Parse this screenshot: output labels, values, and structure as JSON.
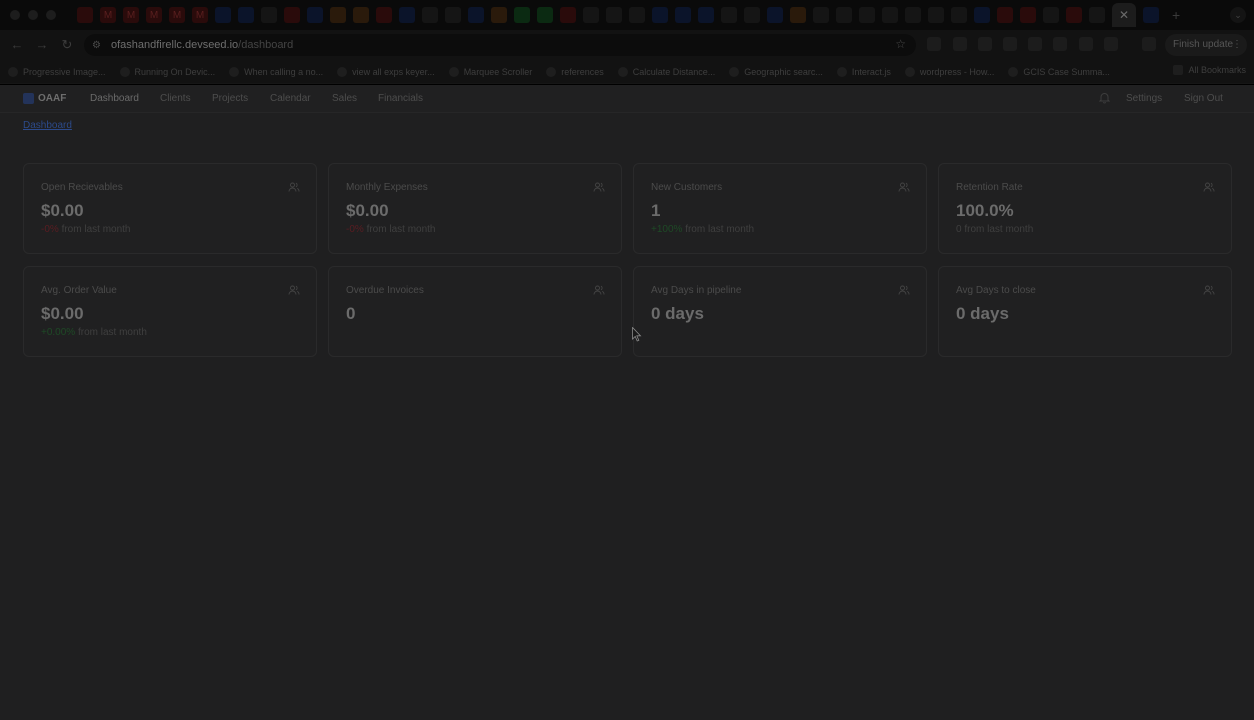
{
  "browser": {
    "url_host": "ofashandfirellc.devseed.io",
    "url_path": "/dashboard",
    "finish_update_label": "Finish update",
    "bookmarks": [
      "Progressive Image...",
      "Running On Devic...",
      "When calling a no...",
      "view all exps keyer...",
      "Marquee Scroller",
      "references",
      "Calculate Distance...",
      "Geographic searc...",
      "Interact.js",
      "wordpress - How...",
      "GCIS Case Summa..."
    ],
    "all_bookmarks_label": "All Bookmarks"
  },
  "app": {
    "brand": "OAAF",
    "nav": [
      "Dashboard",
      "Clients",
      "Projects",
      "Calendar",
      "Sales",
      "Financials"
    ],
    "settings_label": "Settings",
    "signout_label": "Sign Out",
    "breadcrumb": "Dashboard"
  },
  "cards": [
    {
      "title": "Open Recievables",
      "value": "$0.00",
      "delta": "-0%",
      "delta_tone": "negative",
      "suffix": " from last month"
    },
    {
      "title": "Monthly Expenses",
      "value": "$0.00",
      "delta": "-0%",
      "delta_tone": "negative",
      "suffix": " from last month"
    },
    {
      "title": "New Customers",
      "value": "1",
      "delta": "+100%",
      "delta_tone": "positive",
      "suffix": " from last month"
    },
    {
      "title": "Retention Rate",
      "value": "100.0%",
      "delta": "0",
      "delta_tone": "neutral",
      "suffix": " from last month"
    },
    {
      "title": "Avg. Order Value",
      "value": "$0.00",
      "delta": "+0.00%",
      "delta_tone": "positive",
      "suffix": " from last month"
    },
    {
      "title": "Overdue Invoices",
      "value": "0",
      "delta": "",
      "delta_tone": "neutral",
      "suffix": ""
    },
    {
      "title": "Avg Days in pipeline",
      "value": "0 days",
      "delta": "",
      "delta_tone": "neutral",
      "suffix": ""
    },
    {
      "title": "Avg Days to close",
      "value": "0 days",
      "delta": "",
      "delta_tone": "neutral",
      "suffix": ""
    }
  ],
  "icons": {
    "card_icon": "users-icon",
    "bell": "bell-icon",
    "star": "star-icon"
  }
}
